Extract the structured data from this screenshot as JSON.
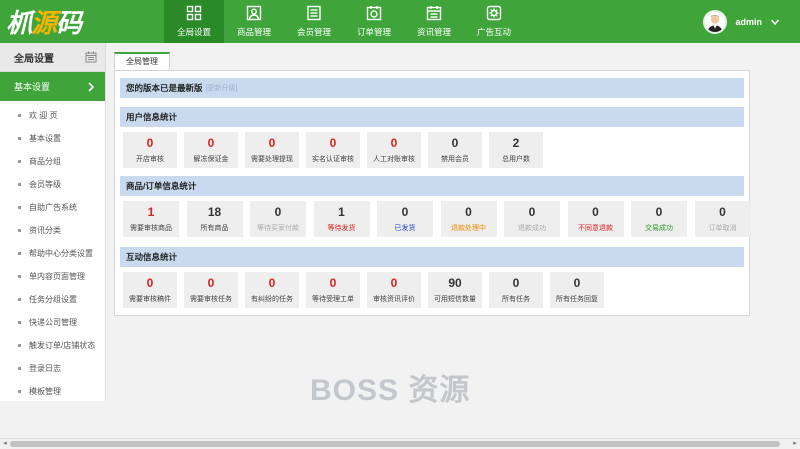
{
  "logo": {
    "part1": "枛",
    "part2": "源",
    "part3": "码"
  },
  "nav": [
    {
      "label": "全局设置",
      "icon": "grid-icon",
      "active": true
    },
    {
      "label": "商品管理",
      "icon": "person-badge-icon"
    },
    {
      "label": "会员管理",
      "icon": "list-icon"
    },
    {
      "label": "订单管理",
      "icon": "camera-icon"
    },
    {
      "label": "资讯管理",
      "icon": "calendar-icon"
    },
    {
      "label": "广告互动",
      "icon": "gear-icon"
    }
  ],
  "user": {
    "name": "admin"
  },
  "sidebar": {
    "header": "全局设置",
    "section": "基本设置",
    "items": [
      "欢 迎 页",
      "基本设置",
      "商品分组",
      "会员等级",
      "自助广告系统",
      "资讯分类",
      "帮助中心分类设置",
      "单内容页面管理",
      "任务分组设置",
      "快递公司管理",
      "触发订单/店铺状态",
      "登录日志",
      "模板管理"
    ]
  },
  "tab": "全局管理",
  "version": {
    "text": "您的版本已是最新版",
    "hint": "[更新升级]"
  },
  "user_stats": {
    "title": "用户信息统计",
    "cards": [
      {
        "num": "0",
        "label": "开店审核",
        "num_red": true
      },
      {
        "num": "0",
        "label": "解冻保证金",
        "num_red": true
      },
      {
        "num": "0",
        "label": "需要处理提现",
        "num_red": true
      },
      {
        "num": "0",
        "label": "实名认证审核",
        "num_red": true
      },
      {
        "num": "0",
        "label": "人工对账审核",
        "num_red": true
      },
      {
        "num": "0",
        "label": "禁用会员"
      },
      {
        "num": "2",
        "label": "总用户数"
      }
    ]
  },
  "order_stats": {
    "title": "商品/订单信息统计",
    "cards": [
      {
        "num": "1",
        "label": "需要审核商品",
        "num_red": true
      },
      {
        "num": "18",
        "label": "所有商品"
      },
      {
        "num": "0",
        "label": "等待买家付款",
        "label_color": "gray"
      },
      {
        "num": "1",
        "label": "等待发货",
        "label_color": "red"
      },
      {
        "num": "0",
        "label": "已发货",
        "label_color": "blue"
      },
      {
        "num": "0",
        "label": "退款处理中",
        "label_color": "orange"
      },
      {
        "num": "0",
        "label": "退款成功",
        "label_color": "gray"
      },
      {
        "num": "0",
        "label": "不同意退款",
        "label_color": "red"
      },
      {
        "num": "0",
        "label": "交易成功",
        "label_color": "green"
      },
      {
        "num": "0",
        "label": "订单取消",
        "label_color": "gray"
      }
    ]
  },
  "interact_stats": {
    "title": "互动信息统计",
    "cards": [
      {
        "num": "0",
        "label": "需要审核稿件",
        "num_red": true
      },
      {
        "num": "0",
        "label": "需要审核任务",
        "num_red": true
      },
      {
        "num": "0",
        "label": "有纠纷的任务",
        "num_red": true
      },
      {
        "num": "0",
        "label": "等待受理工单",
        "num_red": true
      },
      {
        "num": "0",
        "label": "审核资讯评价",
        "num_red": true
      },
      {
        "num": "90",
        "label": "可用短信数量"
      },
      {
        "num": "0",
        "label": "所有任务"
      },
      {
        "num": "0",
        "label": "所有任务回复"
      }
    ]
  },
  "watermark": "BOSS 资源",
  "colors": {
    "brand_green": "#3fa53b",
    "active_green": "#2a8a28",
    "banner_blue": "#c9daee",
    "alert_red": "#e02020"
  }
}
